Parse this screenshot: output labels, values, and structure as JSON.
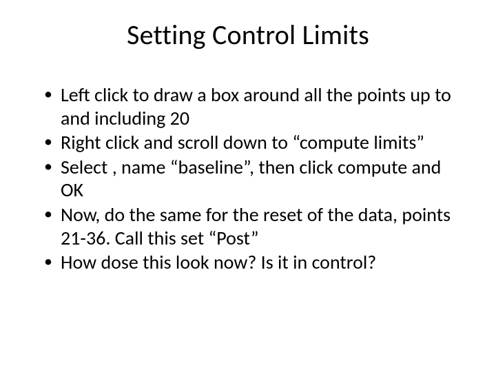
{
  "title": "Setting Control Limits",
  "bullets": [
    "Left click to draw a box around all the points up to and including 20",
    "Right click and scroll down to “compute limits”",
    "Select , name “baseline”, then click compute and OK",
    "Now, do the same for the reset of the data, points 21-36. Call this set “Post”",
    "How dose this look now? Is it in control?"
  ]
}
